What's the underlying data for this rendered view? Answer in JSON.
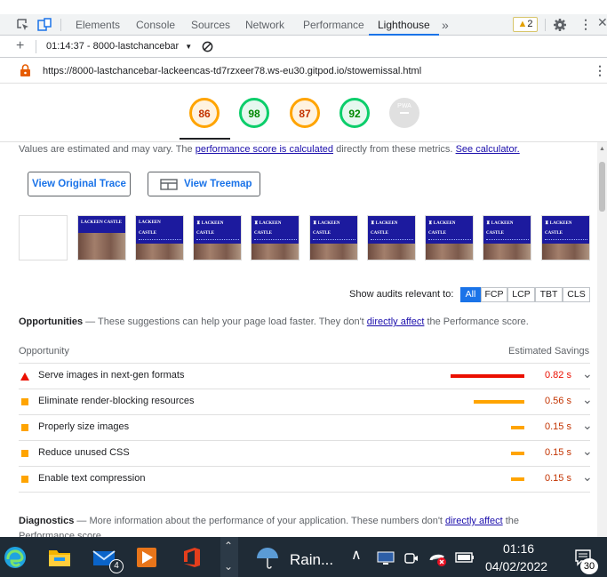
{
  "devtools": {
    "tabs": [
      "Elements",
      "Console",
      "Sources",
      "Network",
      "Performance",
      "Lighthouse"
    ],
    "active_tab": "Lighthouse",
    "more_label": "»",
    "warning_count": "2"
  },
  "report_bar": {
    "report_label": "01:14:37 - 8000-lastchancebar"
  },
  "url": "https://8000-lastchancebar-lackeencas-td7rzxeer78.ws-eu30.gitpod.io/stowemissal.html",
  "gauges": [
    {
      "value": "86",
      "status": "orange"
    },
    {
      "value": "98",
      "status": "green"
    },
    {
      "value": "87",
      "status": "orange"
    },
    {
      "value": "92",
      "status": "green"
    },
    {
      "value": "PWA",
      "status": "gray"
    }
  ],
  "metrics_note": {
    "prefix": "Values are estimated and may vary. The ",
    "link1": "performance score is calculated",
    "middle": " directly from these metrics. ",
    "link2": "See calculator."
  },
  "buttons": {
    "trace": "View Original Trace",
    "treemap": "View Treemap"
  },
  "thumbnails": [
    {
      "line1": "",
      "line2": ""
    },
    {
      "line1": "LACKEEN CASTLE",
      "line2": ""
    },
    {
      "line1": "LACKEEN",
      "line2": "CASTLE"
    },
    {
      "line1": "♜ LACKEEN",
      "line2": "CASTLE"
    },
    {
      "line1": "♜ LACKEEN",
      "line2": "CASTLE"
    },
    {
      "line1": "♜ LACKEEN",
      "line2": "CASTLE"
    },
    {
      "line1": "♜ LACKEEN",
      "line2": "CASTLE"
    },
    {
      "line1": "♜ LACKEEN",
      "line2": "CASTLE"
    },
    {
      "line1": "♜ LACKEEN",
      "line2": "CASTLE"
    },
    {
      "line1": "♜ LACKEEN",
      "line2": "CASTLE"
    }
  ],
  "filter": {
    "label": "Show audits relevant to:",
    "options": [
      "All",
      "FCP",
      "LCP",
      "TBT",
      "CLS"
    ],
    "active": "All"
  },
  "opportunities": {
    "heading": "Opportunities",
    "desc_prefix": " — These suggestions can help your page load faster. They don't ",
    "desc_link": "directly affect",
    "desc_suffix": " the Performance score.",
    "col_opportunity": "Opportunity",
    "col_savings": "Estimated Savings",
    "items": [
      {
        "title": "Serve images in next-gen formats",
        "savings": "0.82 s",
        "severity": "fail",
        "fraction": 0.92
      },
      {
        "title": "Eliminate render-blocking resources",
        "savings": "0.56 s",
        "severity": "average",
        "fraction": 0.63
      },
      {
        "title": "Properly size images",
        "savings": "0.15 s",
        "severity": "average",
        "fraction": 0.17
      },
      {
        "title": "Reduce unused CSS",
        "savings": "0.15 s",
        "severity": "average",
        "fraction": 0.17
      },
      {
        "title": "Enable text compression",
        "savings": "0.15 s",
        "severity": "average",
        "fraction": 0.17
      }
    ]
  },
  "diagnostics": {
    "heading": "Diagnostics",
    "desc_prefix": " — More information about the performance of your application. These numbers don't ",
    "desc_link": "directly affect",
    "desc_suffix": " the Performance score."
  },
  "taskbar": {
    "weather": "Rain...",
    "mail_badge": "4",
    "time": "01:16",
    "date": "04/02/2022",
    "notif_count": "30"
  },
  "colors": {
    "fail": "#eb0f00",
    "average": "#ffa400",
    "pass": "#0cce6b",
    "accent": "#1a73e8"
  }
}
